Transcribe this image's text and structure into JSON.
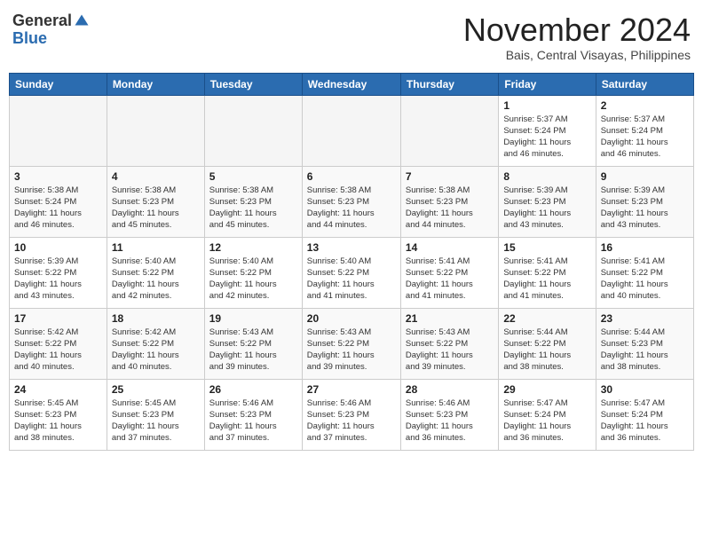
{
  "header": {
    "logo_general": "General",
    "logo_blue": "Blue",
    "month": "November 2024",
    "location": "Bais, Central Visayas, Philippines"
  },
  "columns": [
    "Sunday",
    "Monday",
    "Tuesday",
    "Wednesday",
    "Thursday",
    "Friday",
    "Saturday"
  ],
  "weeks": [
    [
      {
        "day": "",
        "info": ""
      },
      {
        "day": "",
        "info": ""
      },
      {
        "day": "",
        "info": ""
      },
      {
        "day": "",
        "info": ""
      },
      {
        "day": "",
        "info": ""
      },
      {
        "day": "1",
        "info": "Sunrise: 5:37 AM\nSunset: 5:24 PM\nDaylight: 11 hours\nand 46 minutes."
      },
      {
        "day": "2",
        "info": "Sunrise: 5:37 AM\nSunset: 5:24 PM\nDaylight: 11 hours\nand 46 minutes."
      }
    ],
    [
      {
        "day": "3",
        "info": "Sunrise: 5:38 AM\nSunset: 5:24 PM\nDaylight: 11 hours\nand 46 minutes."
      },
      {
        "day": "4",
        "info": "Sunrise: 5:38 AM\nSunset: 5:23 PM\nDaylight: 11 hours\nand 45 minutes."
      },
      {
        "day": "5",
        "info": "Sunrise: 5:38 AM\nSunset: 5:23 PM\nDaylight: 11 hours\nand 45 minutes."
      },
      {
        "day": "6",
        "info": "Sunrise: 5:38 AM\nSunset: 5:23 PM\nDaylight: 11 hours\nand 44 minutes."
      },
      {
        "day": "7",
        "info": "Sunrise: 5:38 AM\nSunset: 5:23 PM\nDaylight: 11 hours\nand 44 minutes."
      },
      {
        "day": "8",
        "info": "Sunrise: 5:39 AM\nSunset: 5:23 PM\nDaylight: 11 hours\nand 43 minutes."
      },
      {
        "day": "9",
        "info": "Sunrise: 5:39 AM\nSunset: 5:23 PM\nDaylight: 11 hours\nand 43 minutes."
      }
    ],
    [
      {
        "day": "10",
        "info": "Sunrise: 5:39 AM\nSunset: 5:22 PM\nDaylight: 11 hours\nand 43 minutes."
      },
      {
        "day": "11",
        "info": "Sunrise: 5:40 AM\nSunset: 5:22 PM\nDaylight: 11 hours\nand 42 minutes."
      },
      {
        "day": "12",
        "info": "Sunrise: 5:40 AM\nSunset: 5:22 PM\nDaylight: 11 hours\nand 42 minutes."
      },
      {
        "day": "13",
        "info": "Sunrise: 5:40 AM\nSunset: 5:22 PM\nDaylight: 11 hours\nand 41 minutes."
      },
      {
        "day": "14",
        "info": "Sunrise: 5:41 AM\nSunset: 5:22 PM\nDaylight: 11 hours\nand 41 minutes."
      },
      {
        "day": "15",
        "info": "Sunrise: 5:41 AM\nSunset: 5:22 PM\nDaylight: 11 hours\nand 41 minutes."
      },
      {
        "day": "16",
        "info": "Sunrise: 5:41 AM\nSunset: 5:22 PM\nDaylight: 11 hours\nand 40 minutes."
      }
    ],
    [
      {
        "day": "17",
        "info": "Sunrise: 5:42 AM\nSunset: 5:22 PM\nDaylight: 11 hours\nand 40 minutes."
      },
      {
        "day": "18",
        "info": "Sunrise: 5:42 AM\nSunset: 5:22 PM\nDaylight: 11 hours\nand 40 minutes."
      },
      {
        "day": "19",
        "info": "Sunrise: 5:43 AM\nSunset: 5:22 PM\nDaylight: 11 hours\nand 39 minutes."
      },
      {
        "day": "20",
        "info": "Sunrise: 5:43 AM\nSunset: 5:22 PM\nDaylight: 11 hours\nand 39 minutes."
      },
      {
        "day": "21",
        "info": "Sunrise: 5:43 AM\nSunset: 5:22 PM\nDaylight: 11 hours\nand 39 minutes."
      },
      {
        "day": "22",
        "info": "Sunrise: 5:44 AM\nSunset: 5:22 PM\nDaylight: 11 hours\nand 38 minutes."
      },
      {
        "day": "23",
        "info": "Sunrise: 5:44 AM\nSunset: 5:23 PM\nDaylight: 11 hours\nand 38 minutes."
      }
    ],
    [
      {
        "day": "24",
        "info": "Sunrise: 5:45 AM\nSunset: 5:23 PM\nDaylight: 11 hours\nand 38 minutes."
      },
      {
        "day": "25",
        "info": "Sunrise: 5:45 AM\nSunset: 5:23 PM\nDaylight: 11 hours\nand 37 minutes."
      },
      {
        "day": "26",
        "info": "Sunrise: 5:46 AM\nSunset: 5:23 PM\nDaylight: 11 hours\nand 37 minutes."
      },
      {
        "day": "27",
        "info": "Sunrise: 5:46 AM\nSunset: 5:23 PM\nDaylight: 11 hours\nand 37 minutes."
      },
      {
        "day": "28",
        "info": "Sunrise: 5:46 AM\nSunset: 5:23 PM\nDaylight: 11 hours\nand 36 minutes."
      },
      {
        "day": "29",
        "info": "Sunrise: 5:47 AM\nSunset: 5:24 PM\nDaylight: 11 hours\nand 36 minutes."
      },
      {
        "day": "30",
        "info": "Sunrise: 5:47 AM\nSunset: 5:24 PM\nDaylight: 11 hours\nand 36 minutes."
      }
    ]
  ]
}
